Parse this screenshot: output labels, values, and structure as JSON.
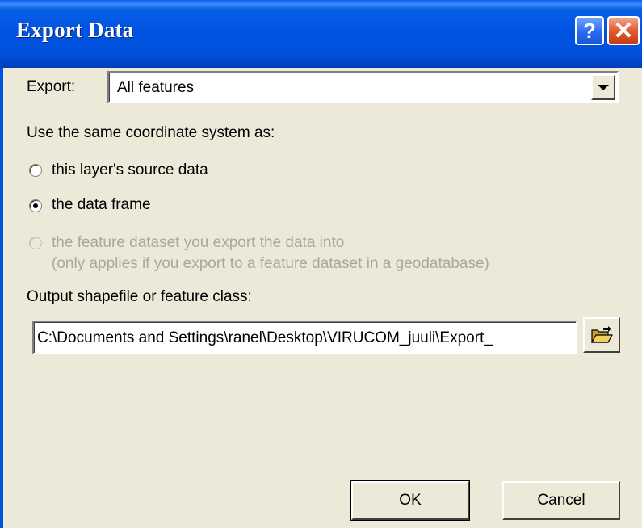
{
  "window": {
    "title": "Export Data",
    "help_label": "?",
    "close_label": "✕"
  },
  "export": {
    "label": "Export:",
    "selected": "All features"
  },
  "coordinate": {
    "heading": "Use the same coordinate system as:",
    "options": [
      {
        "label": "this layer's source data",
        "selected": false,
        "enabled": true
      },
      {
        "label": "the data frame",
        "selected": true,
        "enabled": true
      },
      {
        "label": "the feature dataset you export the data into",
        "sublabel": "(only applies if you export to a feature dataset in a geodatabase)",
        "selected": false,
        "enabled": false
      }
    ]
  },
  "output": {
    "label": "Output shapefile or feature class:",
    "path": "C:\\Documents and Settings\\ranel\\Desktop\\VIRUCOM_juuli\\Export_",
    "browse_icon": "open-folder-icon"
  },
  "buttons": {
    "ok": "OK",
    "cancel": "Cancel"
  }
}
